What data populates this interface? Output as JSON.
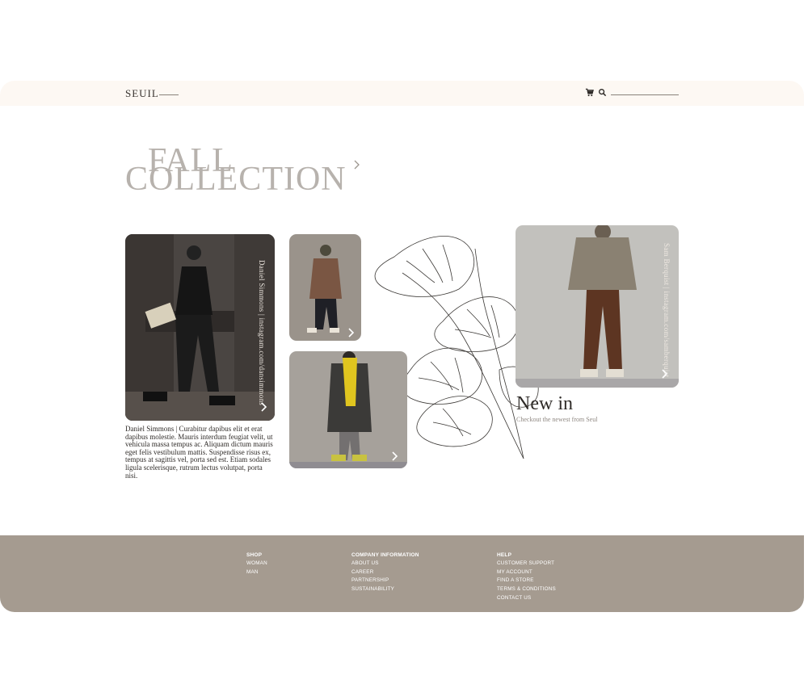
{
  "header": {
    "logo": "SEUIL"
  },
  "hero": {
    "title_line1": "FALL",
    "title_line2": "COLLECTION"
  },
  "cards": {
    "card1_credit": "Daniel Simmons | instagram.com/dansimmons",
    "card4_credit": "Sam Berquist | instagram.com/samberquist"
  },
  "caption": "Daniel Simmons | Curabitur dapibus elit et erat dapibus molestie. Mauris interdum feugiat velit, ut vehicula massa tempus ac. Aliquam dictum mauris eget felis vestibulum mattis. Suspendisse risus ex, tempus at sagittis vel, porta sed est. Etiam sodales ligula scelerisque, rutrum lectus volutpat, porta nisi.",
  "new_in": {
    "title": "New in",
    "subtitle": "Checkout the newest from Seul"
  },
  "footer": {
    "shop": {
      "heading": "SHOP",
      "items": [
        "WOMAN",
        "MAN"
      ]
    },
    "company": {
      "heading": "COMPANY INFORMATION",
      "items": [
        "ABOUT US",
        "CAREER",
        "PARTNERSHIP",
        "SUSTAINABILITY"
      ]
    },
    "help": {
      "heading": "HELP",
      "items": [
        "CUSTOMER SUPPORT",
        "MY ACCOUNT",
        "FIND A STORE",
        "TERMS & CONDITIONS",
        "CONTACT US"
      ]
    }
  },
  "colors": {
    "header_bg": "#fdf8f3",
    "footer_bg": "#a59b90",
    "title_gray": "#b7b2ad"
  }
}
